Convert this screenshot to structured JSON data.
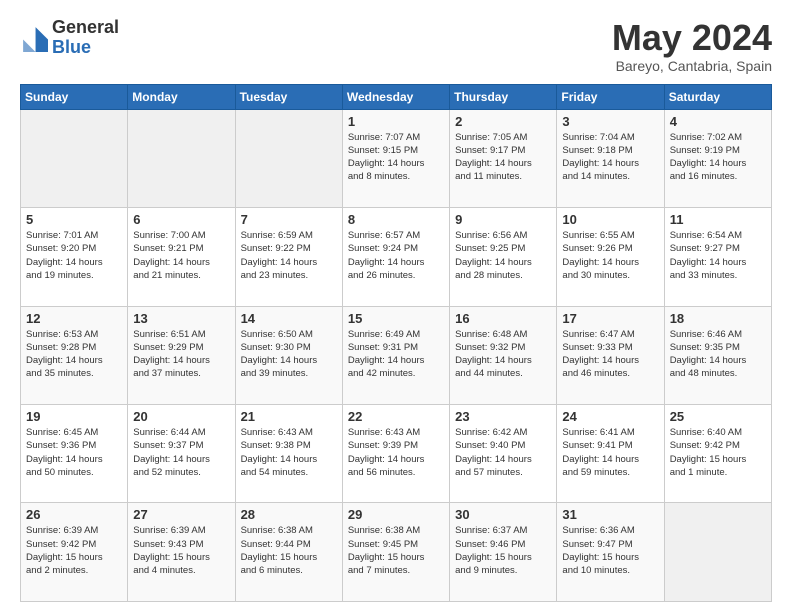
{
  "header": {
    "logo_general": "General",
    "logo_blue": "Blue",
    "month": "May 2024",
    "location": "Bareyo, Cantabria, Spain"
  },
  "weekdays": [
    "Sunday",
    "Monday",
    "Tuesday",
    "Wednesday",
    "Thursday",
    "Friday",
    "Saturday"
  ],
  "weeks": [
    [
      {
        "day": "",
        "info": ""
      },
      {
        "day": "",
        "info": ""
      },
      {
        "day": "",
        "info": ""
      },
      {
        "day": "1",
        "info": "Sunrise: 7:07 AM\nSunset: 9:15 PM\nDaylight: 14 hours\nand 8 minutes."
      },
      {
        "day": "2",
        "info": "Sunrise: 7:05 AM\nSunset: 9:17 PM\nDaylight: 14 hours\nand 11 minutes."
      },
      {
        "day": "3",
        "info": "Sunrise: 7:04 AM\nSunset: 9:18 PM\nDaylight: 14 hours\nand 14 minutes."
      },
      {
        "day": "4",
        "info": "Sunrise: 7:02 AM\nSunset: 9:19 PM\nDaylight: 14 hours\nand 16 minutes."
      }
    ],
    [
      {
        "day": "5",
        "info": "Sunrise: 7:01 AM\nSunset: 9:20 PM\nDaylight: 14 hours\nand 19 minutes."
      },
      {
        "day": "6",
        "info": "Sunrise: 7:00 AM\nSunset: 9:21 PM\nDaylight: 14 hours\nand 21 minutes."
      },
      {
        "day": "7",
        "info": "Sunrise: 6:59 AM\nSunset: 9:22 PM\nDaylight: 14 hours\nand 23 minutes."
      },
      {
        "day": "8",
        "info": "Sunrise: 6:57 AM\nSunset: 9:24 PM\nDaylight: 14 hours\nand 26 minutes."
      },
      {
        "day": "9",
        "info": "Sunrise: 6:56 AM\nSunset: 9:25 PM\nDaylight: 14 hours\nand 28 minutes."
      },
      {
        "day": "10",
        "info": "Sunrise: 6:55 AM\nSunset: 9:26 PM\nDaylight: 14 hours\nand 30 minutes."
      },
      {
        "day": "11",
        "info": "Sunrise: 6:54 AM\nSunset: 9:27 PM\nDaylight: 14 hours\nand 33 minutes."
      }
    ],
    [
      {
        "day": "12",
        "info": "Sunrise: 6:53 AM\nSunset: 9:28 PM\nDaylight: 14 hours\nand 35 minutes."
      },
      {
        "day": "13",
        "info": "Sunrise: 6:51 AM\nSunset: 9:29 PM\nDaylight: 14 hours\nand 37 minutes."
      },
      {
        "day": "14",
        "info": "Sunrise: 6:50 AM\nSunset: 9:30 PM\nDaylight: 14 hours\nand 39 minutes."
      },
      {
        "day": "15",
        "info": "Sunrise: 6:49 AM\nSunset: 9:31 PM\nDaylight: 14 hours\nand 42 minutes."
      },
      {
        "day": "16",
        "info": "Sunrise: 6:48 AM\nSunset: 9:32 PM\nDaylight: 14 hours\nand 44 minutes."
      },
      {
        "day": "17",
        "info": "Sunrise: 6:47 AM\nSunset: 9:33 PM\nDaylight: 14 hours\nand 46 minutes."
      },
      {
        "day": "18",
        "info": "Sunrise: 6:46 AM\nSunset: 9:35 PM\nDaylight: 14 hours\nand 48 minutes."
      }
    ],
    [
      {
        "day": "19",
        "info": "Sunrise: 6:45 AM\nSunset: 9:36 PM\nDaylight: 14 hours\nand 50 minutes."
      },
      {
        "day": "20",
        "info": "Sunrise: 6:44 AM\nSunset: 9:37 PM\nDaylight: 14 hours\nand 52 minutes."
      },
      {
        "day": "21",
        "info": "Sunrise: 6:43 AM\nSunset: 9:38 PM\nDaylight: 14 hours\nand 54 minutes."
      },
      {
        "day": "22",
        "info": "Sunrise: 6:43 AM\nSunset: 9:39 PM\nDaylight: 14 hours\nand 56 minutes."
      },
      {
        "day": "23",
        "info": "Sunrise: 6:42 AM\nSunset: 9:40 PM\nDaylight: 14 hours\nand 57 minutes."
      },
      {
        "day": "24",
        "info": "Sunrise: 6:41 AM\nSunset: 9:41 PM\nDaylight: 14 hours\nand 59 minutes."
      },
      {
        "day": "25",
        "info": "Sunrise: 6:40 AM\nSunset: 9:42 PM\nDaylight: 15 hours\nand 1 minute."
      }
    ],
    [
      {
        "day": "26",
        "info": "Sunrise: 6:39 AM\nSunset: 9:42 PM\nDaylight: 15 hours\nand 2 minutes."
      },
      {
        "day": "27",
        "info": "Sunrise: 6:39 AM\nSunset: 9:43 PM\nDaylight: 15 hours\nand 4 minutes."
      },
      {
        "day": "28",
        "info": "Sunrise: 6:38 AM\nSunset: 9:44 PM\nDaylight: 15 hours\nand 6 minutes."
      },
      {
        "day": "29",
        "info": "Sunrise: 6:38 AM\nSunset: 9:45 PM\nDaylight: 15 hours\nand 7 minutes."
      },
      {
        "day": "30",
        "info": "Sunrise: 6:37 AM\nSunset: 9:46 PM\nDaylight: 15 hours\nand 9 minutes."
      },
      {
        "day": "31",
        "info": "Sunrise: 6:36 AM\nSunset: 9:47 PM\nDaylight: 15 hours\nand 10 minutes."
      },
      {
        "day": "",
        "info": ""
      }
    ]
  ]
}
